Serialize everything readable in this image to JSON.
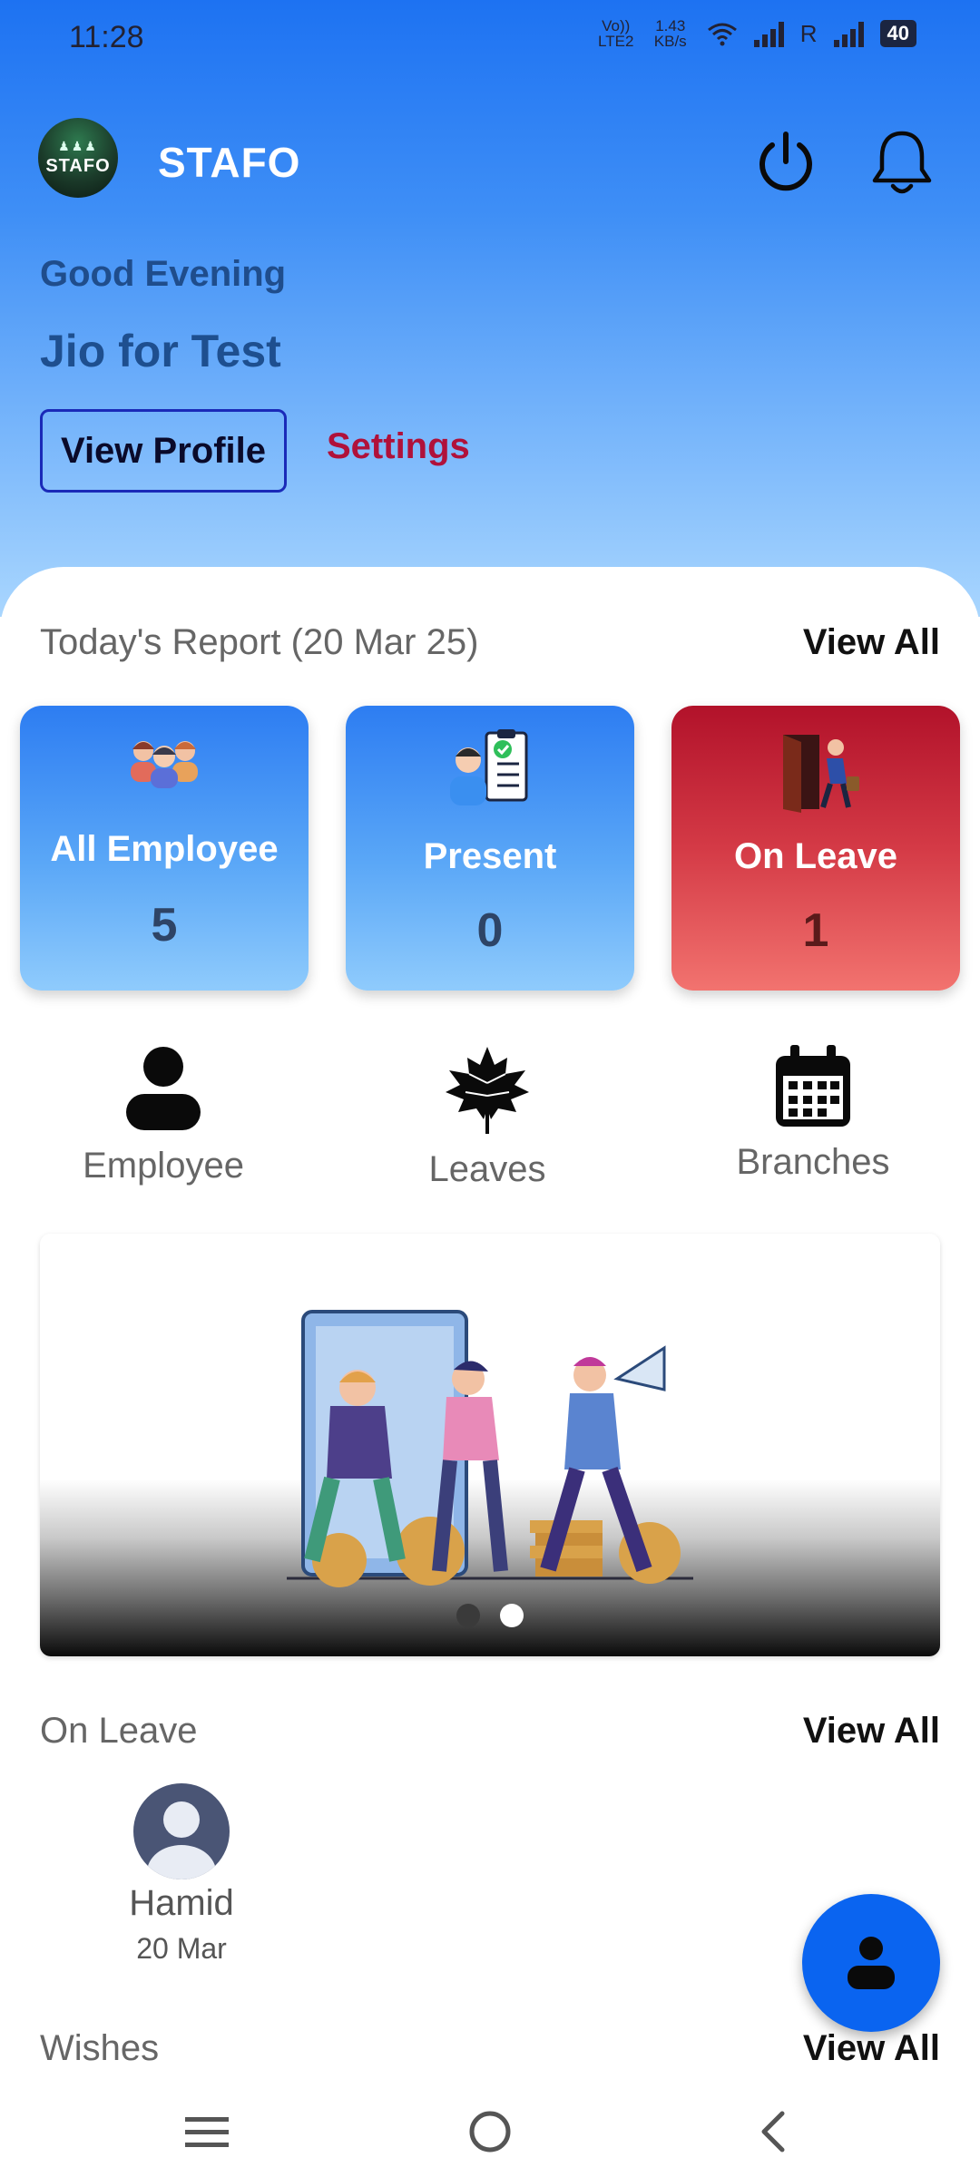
{
  "status": {
    "time": "11:28",
    "network1": "Vo)) LTE2",
    "speed": "1.43 KB/s",
    "roaming": "R",
    "battery": "40"
  },
  "header": {
    "logo_text": "STAFO",
    "title": "STAFO",
    "greeting": "Good Evening",
    "user_name": "Jio for Test",
    "view_profile": "View Profile",
    "settings": "Settings"
  },
  "report": {
    "title": "Today's Report (20 Mar 25)",
    "view_all": "View All",
    "cards": [
      {
        "label": "All Employee",
        "count": "5"
      },
      {
        "label": "Present",
        "count": "0"
      },
      {
        "label": "On Leave",
        "count": "1"
      }
    ]
  },
  "quick_actions": [
    {
      "label": "Employee",
      "icon": "person-icon"
    },
    {
      "label": "Leaves",
      "icon": "leaf-icon"
    },
    {
      "label": "Branches",
      "icon": "calendar-icon"
    }
  ],
  "carousel": {
    "active_index": 1,
    "count": 2
  },
  "on_leave": {
    "title": "On Leave",
    "view_all": "View All",
    "items": [
      {
        "name": "Hamid",
        "date": "20 Mar"
      }
    ]
  },
  "wishes": {
    "title": "Wishes",
    "view_all": "View All"
  },
  "colors": {
    "primary": "#1d72f2",
    "danger": "#b2122a",
    "settings": "#b0113a",
    "fab": "#0a64f0"
  }
}
